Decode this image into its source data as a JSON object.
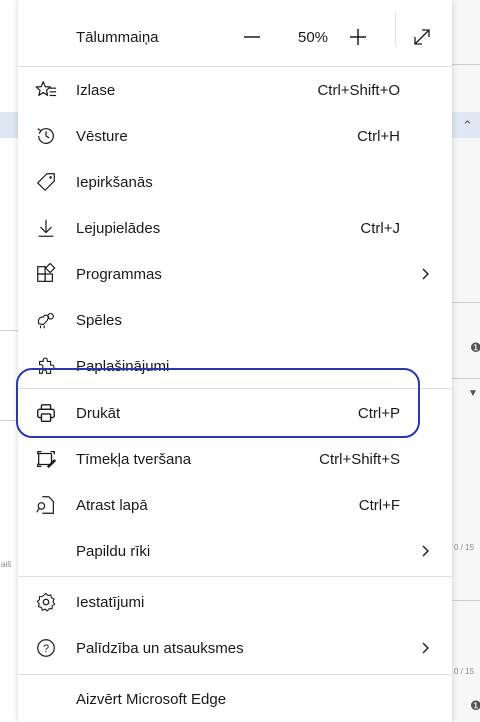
{
  "zoom": {
    "label": "Tālummaiņa",
    "value": "50%"
  },
  "items": [
    {
      "name": "favorites",
      "label": "Izlase",
      "shortcut": "Ctrl+Shift+O",
      "icon": "favorites-icon"
    },
    {
      "name": "history",
      "label": "Vēsture",
      "shortcut": "Ctrl+H",
      "icon": "history-icon"
    },
    {
      "name": "shopping",
      "label": "Iepirkšanās",
      "shortcut": "",
      "icon": "tag-icon"
    },
    {
      "name": "downloads",
      "label": "Lejupielādes",
      "shortcut": "Ctrl+J",
      "icon": "download-icon"
    },
    {
      "name": "apps",
      "label": "Programmas",
      "shortcut": "",
      "icon": "apps-icon",
      "submenu": true
    },
    {
      "name": "games",
      "label": "Spēles",
      "shortcut": "",
      "icon": "games-icon"
    },
    {
      "name": "extensions",
      "label": "Paplašinājumi",
      "shortcut": "",
      "icon": "extensions-icon"
    },
    {
      "name": "print",
      "label": "Drukāt",
      "shortcut": "Ctrl+P",
      "icon": "print-icon"
    },
    {
      "name": "web-capture",
      "label": "Tīmekļa tveršana",
      "shortcut": "Ctrl+Shift+S",
      "icon": "web-capture-icon"
    },
    {
      "name": "find",
      "label": "Atrast lapā",
      "shortcut": "Ctrl+F",
      "icon": "find-icon"
    },
    {
      "name": "more-tools",
      "label": "Papildu rīki",
      "shortcut": "",
      "icon": "",
      "submenu": true
    },
    {
      "name": "settings",
      "label": "Iestatījumi",
      "shortcut": "",
      "icon": "gear-icon"
    },
    {
      "name": "help",
      "label": "Palīdzība un atsauksmes",
      "shortcut": "",
      "icon": "help-icon",
      "submenu": true
    },
    {
      "name": "close",
      "label": "Aizvērt Microsoft Edge",
      "shortcut": "",
      "icon": ""
    }
  ],
  "background": {
    "left_text": "aiš",
    "counter_1": "0 / 15",
    "counter_2": "0 / 15"
  },
  "colors": {
    "highlight": "#2b39a8",
    "menu_bg": "#ffffff"
  }
}
